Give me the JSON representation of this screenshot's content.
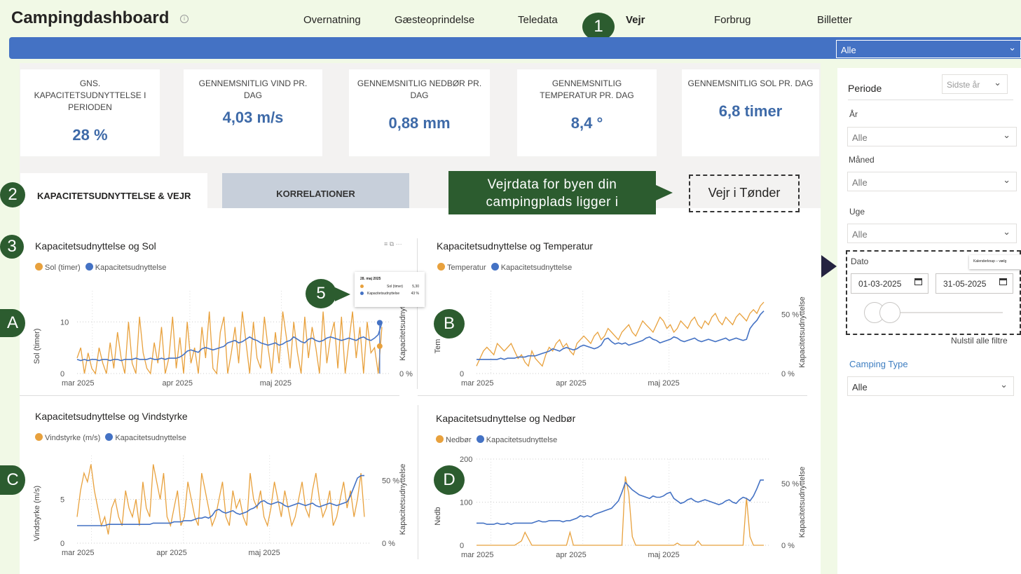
{
  "app": {
    "title": "Campingdashboard"
  },
  "nav": {
    "items": [
      "Overnatning",
      "Gæsteoprindelse",
      "Teledata",
      "Vejr",
      "Forbrug",
      "Billetter"
    ],
    "active": "Vejr"
  },
  "top_filter": {
    "value": "Alle"
  },
  "kpis": [
    {
      "label": "GNS. KAPACITETSUDNYTTELSE I PERIODEN",
      "value": "28 %"
    },
    {
      "label": "GENNEMSNITLIG VIND PR. DAG",
      "value": "4,03 m/s"
    },
    {
      "label": "GENNEMSNITLIG NEDBØR PR. DAG",
      "value": "0,88 mm"
    },
    {
      "label": "GENNEMSNITLIG TEMPERATUR PR. DAG",
      "value": "8,4 °"
    },
    {
      "label": "GENNEMSNITLIG SOL PR. DAG",
      "value": "6,8 timer"
    }
  ],
  "tabs": [
    {
      "label": "KAPACITETSUDNYTTELSE & VEJR",
      "active": true
    },
    {
      "label": "KORRELATIONER",
      "active": false
    }
  ],
  "callout": {
    "text": "Vejrdata for byen din campingplads ligger i"
  },
  "vejr_box": {
    "text": "Vejr i Tønder"
  },
  "badges": [
    "1",
    "2",
    "3",
    "5",
    "A",
    "B",
    "C",
    "D"
  ],
  "tooltip": {
    "date": "28. maj 2025",
    "row1_label": "Sol (timer)",
    "row1_value": "5,30",
    "row2_label": "Kapacitetsudnyttelse",
    "row2_value": "43 %"
  },
  "colors": {
    "orange": "#e8a13d",
    "blue": "#4472c4",
    "green": "#2c5c2f",
    "bg": "#f1f9e6"
  },
  "charts": [
    {
      "id": "A",
      "title": "Kapacitetsudnyttelse og Sol",
      "legend": [
        "Sol (timer)",
        "Kapacitetsudnyttelse"
      ],
      "ylabel": "Sol (timer)",
      "y2label": "Kapacitetsudnytt",
      "yticks": [
        "10",
        "0"
      ],
      "y2ticks": [
        "0 %"
      ],
      "xticks": [
        "mar 2025",
        "apr 2025",
        "maj 2025"
      ]
    },
    {
      "id": "B",
      "title": "Kapacitetsudnyttelse og Temperatur",
      "legend": [
        "Temperatur",
        "Kapacitetsudnyttelse"
      ],
      "ylabel": "Tem",
      "y2label": "Kapacitetsudnyttelse",
      "yticks": [
        "0"
      ],
      "y2ticks": [
        "50 %",
        "0 %"
      ],
      "xticks": [
        "mar 2025",
        "apr 2025",
        "maj 2025"
      ]
    },
    {
      "id": "C",
      "title": "Kapacitetsudnyttelse og Vindstyrke",
      "legend": [
        "Vindstyrke (m/s)",
        "Kapacitetsudnyttelse"
      ],
      "ylabel": "Vindstyrke (m/s)",
      "y2label": "Kapacitetsudnyttelse",
      "yticks": [
        "5",
        "0"
      ],
      "y2ticks": [
        "50 %",
        "0 %"
      ],
      "xticks": [
        "mar 2025",
        "apr 2025",
        "maj 2025"
      ]
    },
    {
      "id": "D",
      "title": "Kapacitetsudnyttelse og Nedbør",
      "legend": [
        "Nedbør",
        "Kapacitetsudnyttelse"
      ],
      "ylabel": "Nedb",
      "y2label": "Kapacitetsudnyttelse",
      "yticks": [
        "200",
        "100",
        "0"
      ],
      "y2ticks": [
        "50 %",
        "0 %"
      ],
      "xticks": [
        "mar 2025",
        "apr 2025",
        "maj 2025"
      ]
    }
  ],
  "chart_data": [
    {
      "type": "line",
      "title": "Kapacitetsudnyttelse og Sol",
      "series": [
        {
          "name": "Sol (timer)",
          "axis": "left",
          "values": [
            3,
            5,
            0,
            4,
            1,
            0,
            5,
            2,
            0,
            6,
            1,
            8,
            3,
            0,
            10,
            2,
            0,
            11,
            4,
            1,
            0,
            6,
            2,
            9,
            0,
            3,
            11,
            1,
            7,
            0,
            10,
            2,
            5,
            0,
            9,
            3,
            12,
            1,
            0,
            8,
            11,
            0,
            4,
            9,
            2,
            12,
            6,
            0,
            10,
            3,
            1,
            11,
            5,
            0,
            8,
            2,
            12,
            7,
            1,
            10,
            4,
            0,
            11,
            3,
            9,
            5,
            0,
            12,
            2,
            7,
            10,
            1,
            11,
            0,
            6,
            12,
            3,
            9,
            0,
            10,
            4,
            5,
            0,
            9
          ]
        },
        {
          "name": "Kapacitetsudnyttelse",
          "axis": "right",
          "values": [
            12,
            11,
            12,
            11,
            12,
            12,
            11,
            12,
            12,
            11,
            12,
            12,
            11,
            12,
            12,
            12,
            13,
            12,
            12,
            12,
            13,
            12,
            12,
            13,
            12,
            13,
            13,
            13,
            14,
            16,
            19,
            20,
            19,
            18,
            21,
            22,
            21,
            20,
            21,
            22,
            23,
            26,
            27,
            28,
            26,
            27,
            29,
            31,
            29,
            28,
            26,
            25,
            24,
            25,
            26,
            24,
            25,
            27,
            28,
            31,
            29,
            27,
            26,
            29,
            30,
            28,
            27,
            28,
            30,
            31,
            30,
            29,
            28,
            29,
            30,
            29,
            28,
            30,
            31,
            29,
            28,
            30,
            33,
            43
          ]
        }
      ]
    },
    {
      "type": "line",
      "title": "Kapacitetsudnyttelse og Temperatur",
      "series": [
        {
          "name": "Temperatur",
          "axis": "left",
          "values": [
            2,
            4,
            6,
            7,
            6,
            5,
            8,
            7,
            6,
            7,
            8,
            6,
            4,
            5,
            3,
            2,
            6,
            4,
            3,
            2,
            5,
            7,
            6,
            8,
            9,
            7,
            8,
            6,
            5,
            8,
            9,
            10,
            9,
            8,
            10,
            11,
            9,
            10,
            12,
            11,
            10,
            9,
            11,
            12,
            13,
            11,
            10,
            12,
            14,
            13,
            12,
            11,
            13,
            15,
            14,
            12,
            13,
            11,
            12,
            14,
            13,
            12,
            14,
            15,
            13,
            12,
            14,
            13,
            15,
            16,
            14,
            13,
            15,
            14,
            13,
            15,
            16,
            15,
            14,
            16,
            17,
            16,
            18,
            19
          ]
        },
        {
          "name": "Kapacitetsudnyttelse",
          "axis": "right",
          "values": [
            12,
            12,
            12,
            12,
            12,
            12,
            12,
            13,
            12,
            13,
            13,
            13,
            14,
            14,
            14,
            15,
            15,
            15,
            16,
            17,
            18,
            19,
            21,
            20,
            19,
            21,
            22,
            21,
            20,
            21,
            23,
            24,
            23,
            22,
            21,
            22,
            24,
            29,
            30,
            27,
            25,
            26,
            25,
            26,
            24,
            25,
            26,
            27,
            28,
            30,
            31,
            29,
            28,
            26,
            27,
            28,
            29,
            31,
            30,
            28,
            27,
            28,
            29,
            30,
            28,
            27,
            28,
            29,
            28,
            27,
            28,
            29,
            30,
            28,
            29,
            30,
            29,
            28,
            29,
            38,
            42,
            45,
            50,
            53
          ]
        }
      ]
    },
    {
      "type": "line",
      "title": "Kapacitetsudnyttelse og Vindstyrke",
      "series": [
        {
          "name": "Vindstyrke (m/s)",
          "axis": "left",
          "values": [
            3,
            6,
            8,
            7,
            9,
            6,
            4,
            2,
            3,
            1,
            4,
            5,
            3,
            2,
            6,
            4,
            3,
            5,
            2,
            7,
            4,
            3,
            9,
            7,
            5,
            8,
            3,
            2,
            4,
            6,
            2,
            3,
            7,
            5,
            3,
            2,
            8,
            6,
            4,
            2,
            3,
            5,
            7,
            3,
            2,
            6,
            4,
            5,
            3,
            2,
            8,
            5,
            4,
            6,
            3,
            2,
            4,
            7,
            5,
            3,
            6,
            4,
            2,
            3,
            5,
            7,
            4,
            3,
            6,
            8,
            5,
            3,
            4,
            6,
            2,
            3,
            5,
            7,
            4,
            6,
            3,
            5,
            8,
            3
          ]
        },
        {
          "name": "Kapacitetsudnyttelse",
          "axis": "right",
          "values": [
            14,
            14,
            14,
            14,
            14,
            14,
            14,
            14,
            14,
            15,
            15,
            15,
            15,
            15,
            15,
            15,
            15,
            15,
            15,
            15,
            15,
            15,
            16,
            16,
            16,
            16,
            16,
            16,
            17,
            17,
            17,
            18,
            18,
            18,
            19,
            20,
            20,
            21,
            20,
            22,
            26,
            27,
            25,
            24,
            25,
            26,
            24,
            23,
            24,
            25,
            27,
            28,
            30,
            33,
            34,
            32,
            31,
            32,
            33,
            32,
            30,
            29,
            30,
            31,
            32,
            31,
            30,
            31,
            32,
            30,
            29,
            30,
            31,
            32,
            31,
            30,
            31,
            32,
            33,
            38,
            45,
            52,
            54,
            54
          ]
        }
      ]
    },
    {
      "type": "line",
      "title": "Kapacitetsudnyttelse og Nedbør",
      "series": [
        {
          "name": "Nedbør",
          "axis": "left",
          "values": [
            0,
            0,
            0,
            0,
            0,
            0,
            0,
            0,
            0,
            0,
            0,
            0,
            5,
            10,
            30,
            15,
            0,
            0,
            0,
            0,
            0,
            0,
            0,
            0,
            0,
            0,
            0,
            30,
            0,
            0,
            0,
            0,
            0,
            0,
            0,
            0,
            0,
            0,
            0,
            0,
            0,
            0,
            0,
            160,
            120,
            20,
            0,
            0,
            0,
            0,
            0,
            0,
            0,
            0,
            0,
            0,
            0,
            0,
            5,
            0,
            0,
            0,
            0,
            0,
            10,
            0,
            0,
            0,
            0,
            0,
            0,
            0,
            0,
            0,
            0,
            0,
            0,
            0,
            110,
            20,
            0,
            0,
            0,
            0
          ]
        },
        {
          "name": "Kapacitetsudnyttelse",
          "axis": "right",
          "values": [
            18,
            18,
            18,
            17,
            17,
            17,
            18,
            17,
            17,
            18,
            17,
            18,
            18,
            18,
            18,
            18,
            18,
            19,
            20,
            19,
            19,
            20,
            20,
            20,
            20,
            19,
            20,
            20,
            21,
            22,
            24,
            23,
            24,
            23,
            25,
            26,
            27,
            28,
            29,
            30,
            33,
            36,
            43,
            51,
            48,
            45,
            43,
            41,
            40,
            39,
            38,
            40,
            39,
            39,
            40,
            42,
            43,
            38,
            36,
            34,
            35,
            37,
            38,
            36,
            35,
            36,
            37,
            36,
            35,
            34,
            33,
            34,
            36,
            37,
            35,
            34,
            37,
            39,
            38,
            36,
            40,
            46,
            53,
            53
          ]
        }
      ]
    }
  ],
  "right_panel": {
    "periode_label": "Periode",
    "periode_value": "Sidste år",
    "aar_label": "År",
    "aar_value": "Alle",
    "maaned_label": "Måned",
    "maaned_value": "Alle",
    "uge_label": "Uge",
    "uge_value": "Alle",
    "dato_label": "Dato",
    "date_from": "01-03-2025",
    "date_to": "31-05-2025",
    "date_range_position": 0,
    "calendar_tooltip": "Kalenderknap – vælg",
    "reset_label": "Nulstil alle filtre",
    "camping_type_label": "Camping Type",
    "camping_type_value": "Alle"
  }
}
